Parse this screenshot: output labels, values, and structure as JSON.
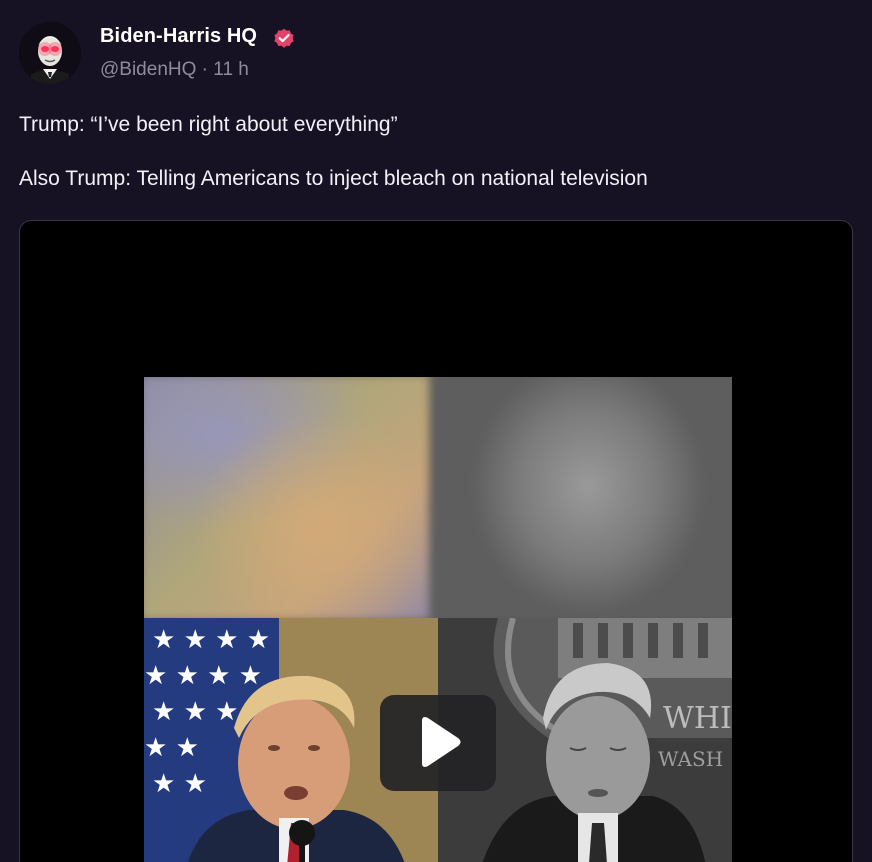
{
  "author": {
    "display_name": "Biden-Harris HQ",
    "handle": "@BidenHQ",
    "separator": "·",
    "time": "11 h",
    "verified": true,
    "avatar_icon": "biden-laser-eyes-avatar-icon",
    "verified_icon": "verified-badge-icon"
  },
  "post": {
    "line1": "Trump: “I’ve been right about everything”",
    "line2": "Also Trump: Telling Americans to inject bleach on national television"
  },
  "media": {
    "type": "video",
    "play_icon": "play-icon"
  },
  "colors": {
    "background": "#161123",
    "verified_badge": "#e3426b",
    "handle_text": "#8f8a9d",
    "media_background": "#000000"
  }
}
